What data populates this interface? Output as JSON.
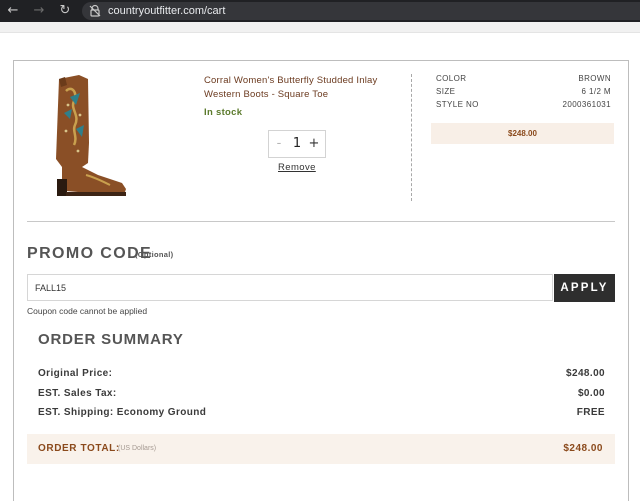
{
  "browser": {
    "url": "countryoutfitter.com/cart",
    "back_icon": "arrow-left-icon",
    "forward_icon": "arrow-right-icon",
    "reload_icon": "reload-icon",
    "site_info_icon": "not-secure-icon"
  },
  "cart": {
    "item": {
      "name": "Corral Women's Butterfly Studded Inlay Western Boots - Square Toe",
      "stock": "In stock",
      "quantity": "1",
      "qty_minus": "-",
      "qty_plus": "+",
      "remove_label": "Remove",
      "attributes": [
        {
          "label": "COLOR",
          "value": "BROWN"
        },
        {
          "label": "SIZE",
          "value": "6 1/2 M"
        },
        {
          "label": "STYLE NO",
          "value": "2000361031"
        }
      ],
      "price": "$248.00",
      "image_icon": "western-boot-image"
    }
  },
  "promo": {
    "title": "PROMO CODE",
    "optional": "(Optional)",
    "code_value": "FALL15",
    "apply_label": "APPLY",
    "error": "Coupon code cannot be applied"
  },
  "summary": {
    "title": "ORDER SUMMARY",
    "rows": [
      {
        "label": "Original Price:",
        "value": "$248.00"
      },
      {
        "label": "EST. Sales Tax:",
        "value": "$0.00"
      },
      {
        "label": "EST. Shipping: Economy Ground",
        "value": "FREE"
      }
    ],
    "total_label": "ORDER TOTAL:",
    "total_currency": "(US Dollars)",
    "total_value": "$248.00"
  },
  "colors": {
    "brand_brown": "#8b4a1c",
    "in_stock_green": "#5b7a2c",
    "price_bg": "#f8efe7",
    "apply_bg": "#2e2e2e"
  }
}
